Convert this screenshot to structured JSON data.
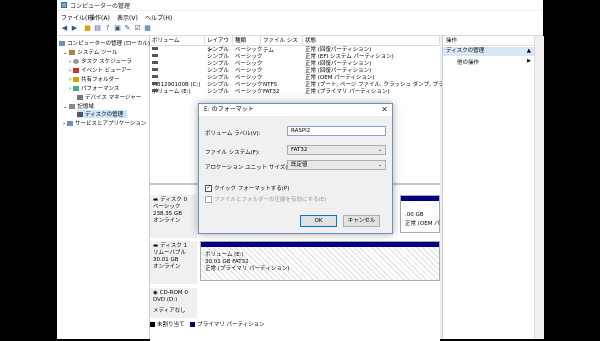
{
  "window": {
    "title": "コンピューターの管理"
  },
  "menu": [
    "ファイル(F)",
    "操作(A)",
    "表示(V)",
    "ヘルプ(H)"
  ],
  "toolbar_icons": [
    "back-arrow-icon",
    "forward-arrow-icon",
    "folder-icon",
    "properties-icon",
    "help-icon",
    "connect-icon",
    "settings-icon",
    "checklist-icon",
    "tree-view-icon"
  ],
  "tree": {
    "root": "コンピューターの管理 (ローカル)",
    "system_tools": "システム ツール",
    "task_scheduler": "タスク スケジューラ",
    "event_viewer": "イベント ビューアー",
    "shared_folders": "共有フォルダー",
    "performance": "パフォーマンス",
    "device_manager": "デバイス マネージャー",
    "storage": "記憶域",
    "disk_management": "ディスクの管理",
    "services": "サービスとアプリケーション"
  },
  "volume_list": {
    "headers": [
      "ボリューム",
      "レイアウト",
      "種類",
      "ファイル システム",
      "状態"
    ],
    "rows": [
      {
        "volume": "",
        "layout": "シンプル",
        "type": "ベーシック",
        "fs": "",
        "status": "正常 (回復パーティション)"
      },
      {
        "volume": "",
        "layout": "シンプル",
        "type": "ベーシック",
        "fs": "",
        "status": "正常 (EFI システム パーティション)"
      },
      {
        "volume": "",
        "layout": "シンプル",
        "type": "ベーシック",
        "fs": "",
        "status": "正常 (回復パーティション)"
      },
      {
        "volume": "",
        "layout": "シンプル",
        "type": "ベーシック",
        "fs": "",
        "status": "正常 (回復パーティション)"
      },
      {
        "volume": "",
        "layout": "シンプル",
        "type": "ベーシック",
        "fs": "",
        "status": "正常 (OEM パーティション)"
      },
      {
        "volume": "TI31290100B (C:)",
        "layout": "シンプル",
        "type": "ベーシック",
        "fs": "NTFS",
        "status": "正常 (ブート, ページ ファイル, クラッシュ ダンプ, プライマリ パ"
      },
      {
        "volume": "ボリューム (E:)",
        "layout": "シンプル",
        "type": "ベーシック",
        "fs": "FAT32",
        "status": "正常 (プライマリ パーティション)"
      }
    ]
  },
  "graphical": {
    "disk0": {
      "name": "ディスク 0",
      "type": "ベーシック",
      "size": "238.35 GB",
      "state": "オンライン",
      "part_size": ".00 GB",
      "part_status": "正常 (OEM パ"
    },
    "disk1": {
      "name": "ディスク 1",
      "type": "リムーバブル",
      "size": "30.01 GB",
      "state": "オンライン",
      "vol_name": "ボリューム (E:)",
      "vol_size": "30.01 GB FAT32",
      "vol_status": "正常 (プライマリ パーティション)"
    },
    "cdrom": {
      "name": "CD-ROM 0",
      "type": "DVD (D:)",
      "media": "メディアなし"
    }
  },
  "legend": {
    "unallocated": "未割り当て",
    "primary": "プライマリ パーティション",
    "unallocated_color": "#000000",
    "primary_color": "#000080"
  },
  "operations": {
    "header": "操作",
    "selected": "ディスクの管理",
    "other": "他の操作"
  },
  "dialog": {
    "title": "E: のフォーマット",
    "volume_label_label": "ボリューム ラベル(V):",
    "volume_label_value": "RASPI2",
    "fs_label": "ファイル システム(F):",
    "fs_value": "FAT32",
    "alloc_label": "アロケーション ユニット サイズ(A):",
    "alloc_value": "既定値",
    "quick_format": "クイック フォーマットする(P)",
    "compression": "ファイルとフォルダーの圧縮を有効にする(E)",
    "ok": "OK",
    "cancel": "キャンセル"
  }
}
